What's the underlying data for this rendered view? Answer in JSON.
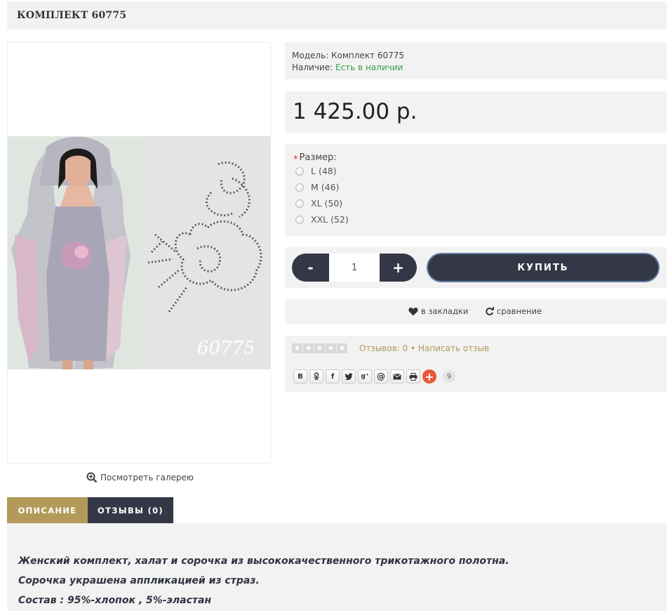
{
  "product": {
    "title": "КОМПЛЕКТ 60775",
    "photo_caption": "60775",
    "gallery_link": "Посмотреть галерею"
  },
  "info": {
    "model_label": "Модель:",
    "model_value": "Комплект 60775",
    "stock_label": "Наличие:",
    "stock_value": "Есть в наличии"
  },
  "price": "1 425.00 р.",
  "options": {
    "required_mark": "*",
    "size_label": "Размер:",
    "sizes": [
      "L (48)",
      "M (46)",
      "XL (50)",
      "XXL (52)"
    ]
  },
  "purchase": {
    "minus_label": "-",
    "plus_label": "+",
    "quantity": "1",
    "buy_label": "КУПИТЬ"
  },
  "links": {
    "bookmark_label": "в закладки",
    "compare_label": "сравнение"
  },
  "reviews": {
    "rating": 0,
    "max_rating": 5,
    "count_label": "Отзывов: 0",
    "separator": "•",
    "write_label": "Написать отзыв"
  },
  "share": {
    "buttons": [
      "B",
      "ok",
      "f",
      "twitter",
      "g+",
      "@",
      "mail",
      "print"
    ],
    "plus_label": "+",
    "count": "9"
  },
  "tabs": [
    {
      "label": "ОПИСАНИЕ",
      "active": true
    },
    {
      "label": "ОТЗЫВЫ (0)",
      "active": false
    }
  ],
  "description": [
    "Женский комплект, халат и сорочка из высококачественного трикотажного полотна.",
    "Сорочка украшена аппликацией из страз.",
    "Состав : 95%-хлопок , 5%-эластан"
  ],
  "colors": {
    "accent_gold": "#b39a5a",
    "dark_button": "#343846",
    "in_stock_green": "#3a9d45",
    "panel_bg": "#f2f2f2"
  }
}
